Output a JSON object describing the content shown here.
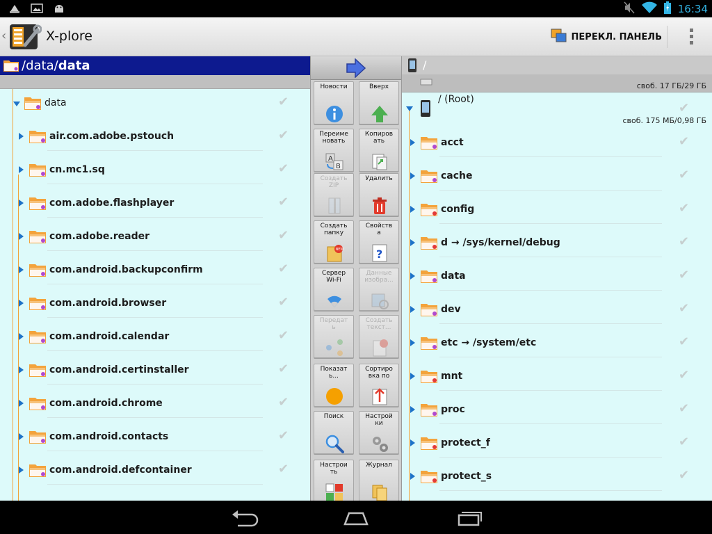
{
  "status_bar": {
    "time": "16:34",
    "left_icons": [
      "bag-icon",
      "image-icon",
      "android-icon"
    ],
    "right_icons": [
      "muted-icon",
      "wifi-icon",
      "battery-charging-icon"
    ]
  },
  "action_bar": {
    "title": "X-plore",
    "switch_panel_label": "ПЕРЕКЛ. ПАНЕЛЬ"
  },
  "left_panel": {
    "path_prefix": "/data/",
    "path_current": "data",
    "root_label": "data",
    "items": [
      "air.com.adobe.pstouch",
      "cn.mc1.sq",
      "com.adobe.flashplayer",
      "com.adobe.reader",
      "com.android.backupconfirm",
      "com.android.browser",
      "com.android.calendar",
      "com.android.certinstaller",
      "com.android.chrome",
      "com.android.contacts",
      "com.android.defcontainer"
    ]
  },
  "toolbar": {
    "tools": [
      {
        "label": "Новости",
        "icon": "info-icon",
        "enabled": true
      },
      {
        "label": "Вверх",
        "icon": "arrow-up-icon",
        "enabled": true
      },
      {
        "label": "Переиме\nновать",
        "icon": "rename-icon",
        "enabled": true
      },
      {
        "label": "Копиров\nать",
        "icon": "copy-icon",
        "enabled": true
      },
      {
        "label": "Создать\nZIP",
        "icon": "zip-icon",
        "enabled": false
      },
      {
        "label": "Удалить",
        "icon": "trash-icon",
        "enabled": true
      },
      {
        "label": "Создать\nпапку",
        "icon": "new-folder-icon",
        "enabled": true
      },
      {
        "label": "Свойств\nа",
        "icon": "properties-icon",
        "enabled": true
      },
      {
        "label": "Сервер\nWi-Fi",
        "icon": "wifi-server-icon",
        "enabled": true
      },
      {
        "label": "Данные\nизобра...",
        "icon": "image-data-icon",
        "enabled": false
      },
      {
        "label": "Передат\nь",
        "icon": "share-icon",
        "enabled": false
      },
      {
        "label": "Создать\nтекст...",
        "icon": "new-text-icon",
        "enabled": false
      },
      {
        "label": "Показат\nь...",
        "icon": "show-icon",
        "enabled": true
      },
      {
        "label": "Сортиро\nвка по",
        "icon": "sort-icon",
        "enabled": true
      },
      {
        "label": "Поиск",
        "icon": "search-icon",
        "enabled": true
      },
      {
        "label": "Настрой\nки",
        "icon": "settings-icon",
        "enabled": true
      },
      {
        "label": "Настрои\nть",
        "icon": "configure-icon",
        "enabled": true
      },
      {
        "label": "Журнал",
        "icon": "log-icon",
        "enabled": true
      }
    ]
  },
  "right_panel": {
    "path": "/",
    "storage_free": "своб. 17 ГБ/29 ГБ",
    "root_label": "/ (Root)",
    "root_free": "своб. 175 МБ/0,98 ГБ",
    "items": [
      "acct",
      "cache",
      "config",
      "d → /sys/kernel/debug",
      "data",
      "dev",
      "etc → /system/etc",
      "mnt",
      "proc",
      "protect_f",
      "protect_s"
    ],
    "item_badge_colors": [
      "#b04ad0",
      "#b04ad0",
      "#e23a3a",
      "#e23a3a",
      "#b04ad0",
      "#b04ad0",
      "#b04ad0",
      "#e23a3a",
      "#b04ad0",
      "#e23a3a",
      "#e23a3a"
    ]
  },
  "colors": {
    "pane_bg": "#ddfafa",
    "header_bg": "#0d1a8f",
    "accent": "#33b5e5",
    "tree_line": "#f2a33a"
  }
}
